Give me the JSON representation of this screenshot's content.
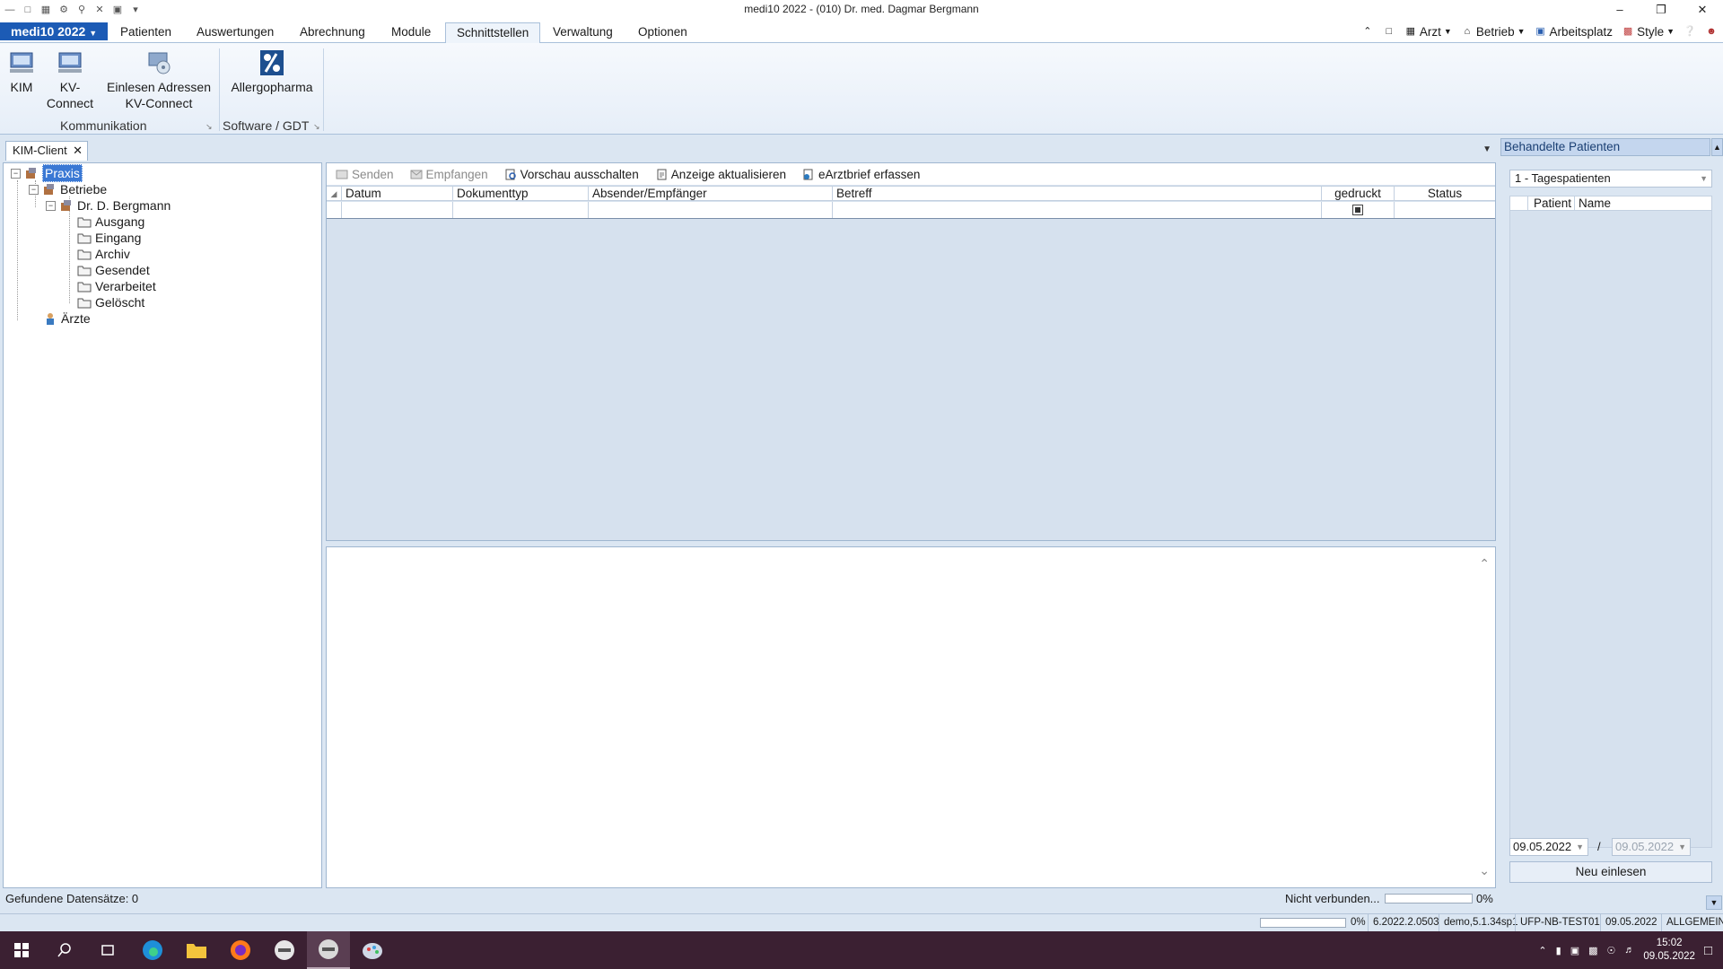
{
  "window": {
    "title": "medi10 2022 - (010) Dr. med. Dagmar Bergmann",
    "controls": [
      "–",
      "❐",
      "✕"
    ]
  },
  "ribbon": {
    "app_button": "medi10 2022",
    "tabs": [
      "Patienten",
      "Auswertungen",
      "Abrechnung",
      "Module",
      "Schnittstellen",
      "Verwaltung",
      "Optionen"
    ],
    "active_tab": "Schnittstellen",
    "right_tools": {
      "arzt": "Arzt",
      "betrieb": "Betrieb",
      "arbeitsplatz": "Arbeitsplatz",
      "style": "Style"
    },
    "buttons": {
      "kim": "KIM",
      "kv_connect_1": "KV-",
      "kv_connect_2": "Connect",
      "einlesen_1": "Einlesen Adressen",
      "einlesen_2": "KV-Connect",
      "allergopharma": "Allergopharma"
    },
    "groups": {
      "kommunikation": "Kommunikation",
      "software_gdt": "Software / GDT"
    }
  },
  "doc_tab": {
    "label": "KIM-Client",
    "close": "✕"
  },
  "tree": {
    "root": "Praxis",
    "betriebe": "Betriebe",
    "doctor": "Dr. D. Bergmann",
    "folders": [
      "Ausgang",
      "Eingang",
      "Archiv",
      "Gesendet",
      "Verarbeitet",
      "Gelöscht"
    ],
    "aerzte": "Ärzte"
  },
  "toolbar": {
    "senden": "Senden",
    "empfangen": "Empfangen",
    "vorschau": "Vorschau ausschalten",
    "aktualisieren": "Anzeige aktualisieren",
    "earztbrief": "eArztbrief erfassen"
  },
  "grid": {
    "columns": {
      "datum": "Datum",
      "dokumenttyp": "Dokumenttyp",
      "absender": "Absender/Empfänger",
      "betreff": "Betreff",
      "gedruckt": "gedruckt",
      "status": "Status"
    }
  },
  "status": {
    "found": "Gefundene Datensätze: 0",
    "connection": "Nicht verbunden...",
    "progress_pct": "0%",
    "progress_value": 0
  },
  "side_panel": {
    "title": "Behandelte Patienten",
    "filter": "1 - Tagespatienten",
    "col_patient": "Patient",
    "col_name": "Name",
    "date_from": "09.05.2022",
    "date_sep": "/",
    "date_to": "09.05.2022",
    "reload_button": "Neu einlesen"
  },
  "app_status": {
    "pct": "0%",
    "version": "6.2022.2.0503",
    "db": "demo,5.1.34sp1",
    "host": "UFP-NB-TEST01",
    "date": "09.05.2022",
    "mode": "ALLGEMEIN"
  },
  "taskbar": {
    "time": "15:02",
    "date": "09.05.2022"
  }
}
